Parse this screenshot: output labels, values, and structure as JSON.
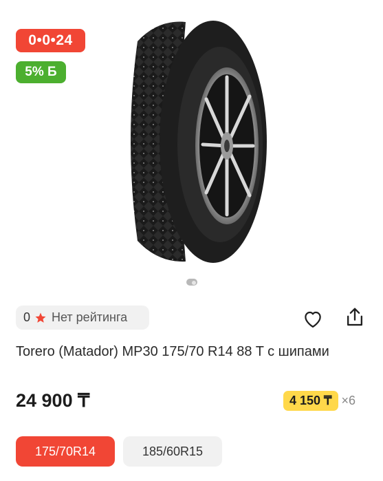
{
  "badges": {
    "timer": "0•0•24",
    "bonus": "5% Б"
  },
  "gallery": {
    "image": "tire-photo",
    "pages_total": 1,
    "page_current": 1
  },
  "rating": {
    "count": "0",
    "label": "Нет рейтинга"
  },
  "actions": {
    "favorite_icon": "heart-icon",
    "share_icon": "share-icon"
  },
  "product": {
    "title": "Torero (Matador) MP30 175/70 R14 88 T с шипами",
    "price": "24 900 ₸"
  },
  "installment": {
    "amount": "4 150 ₸",
    "multiplier": "×6"
  },
  "sizes": [
    {
      "label": "175/70R14",
      "selected": true
    },
    {
      "label": "185/60R15",
      "selected": false
    }
  ],
  "colors": {
    "accent_red": "#f14635",
    "bonus_green": "#4caf2f",
    "installment_yellow": "#ffd84a"
  }
}
